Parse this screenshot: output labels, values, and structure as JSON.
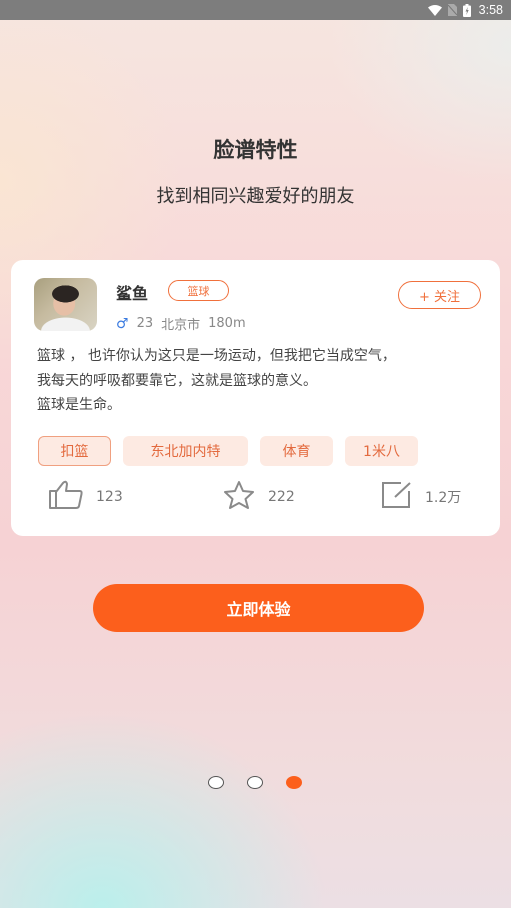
{
  "status_bar": {
    "icons": [
      "wifi-icon",
      "no-sim-icon",
      "battery-charging-icon"
    ],
    "time": "3:58"
  },
  "header": {
    "title": "脸谱特性",
    "subtitle": "找到相同兴趣爱好的朋友"
  },
  "card": {
    "username": "鲨鱼",
    "interest_badge": "篮球",
    "gender_symbol": "♂",
    "age": "23",
    "city": "北京市",
    "distance": "180m",
    "follow_label": "+ 关注",
    "description": [
      "篮球 ， 也许你认为这只是一场运动，但我把它当成空气，",
      "我每天的呼吸都要靠它，这就是篮球的意义。",
      "篮球是生命。"
    ],
    "tags": [
      {
        "label": "扣篮",
        "active": true
      },
      {
        "label": "东北加内特",
        "active": false
      },
      {
        "label": "体育",
        "active": false
      },
      {
        "label": "1米八",
        "active": false
      }
    ],
    "actions": {
      "likes": "123",
      "favorites": "222",
      "comments": "1.2万"
    }
  },
  "cta_label": "立即体验",
  "pager": {
    "total": 3,
    "active_index": 2
  },
  "colors": {
    "accent": "#fc5f1c",
    "tag_bg": "#fdeae2",
    "tag_text": "#e36a3e",
    "gender_male": "#3b7be0"
  }
}
